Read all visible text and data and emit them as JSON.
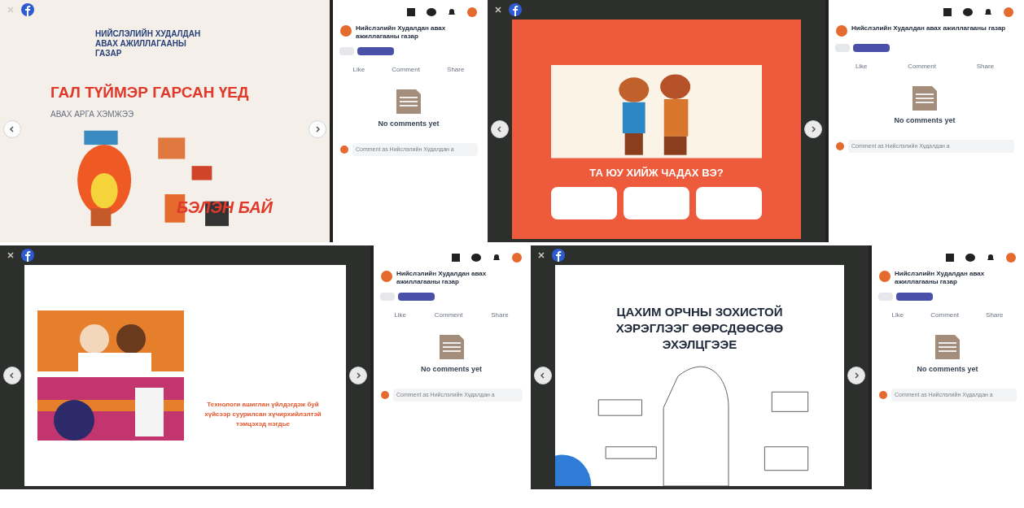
{
  "screens": [
    {
      "poster": {
        "kind": "fire",
        "org": "НИЙСЛЭЛИЙН ХУДАЛДАН АВАХ АЖИЛЛАГААНЫ ГАЗАР",
        "title": "ГАЛ ТҮЙМЭР ГАРСАН ҮЕД",
        "subtitle": "АВАХ АРГА ХЭМЖЭЭ",
        "slogan": "БЭЛЭН БАЙ"
      },
      "sidebar": {
        "author": "Нийслэлийн Худалдан авах ажиллагааны газар",
        "actions": [
          "Like",
          "Comment",
          "Share"
        ],
        "empty": "No comments yet",
        "placeholder": "Comment as Нийслэлийн Худалдан а"
      }
    },
    {
      "poster": {
        "kind": "kids",
        "question": "ТА ЮУ ХИЙЖ ЧАДАХ ВЭ?"
      },
      "sidebar": {
        "author": "Нийслэлийн Худалдан авах ажиллагааны газар",
        "actions": [
          "Like",
          "Comment",
          "Share"
        ],
        "empty": "No comments yet",
        "placeholder": "Comment as Нийслэлийн Худалдан а"
      }
    },
    {
      "poster": {
        "kind": "phones",
        "footer": "Технологи ашиглан үйлдэгдэж буй хүйсээр суурилсан хүчирхийлэлтэй тэмцэхэд нэгдье"
      },
      "sidebar": {
        "author": "Нийслэлийн Худалдан авах ажиллагааны газар",
        "actions": [
          "Like",
          "Comment",
          "Share"
        ],
        "empty": "No comments yet",
        "placeholder": "Comment as Нийслэлийн Худалдан а"
      }
    },
    {
      "poster": {
        "kind": "hands",
        "title": "ЦАХИМ ОРЧНЫ ЗОХИСТОЙ ХЭРЭГЛЭЭГ ӨӨРСДӨӨСӨӨ ЭХЭЛЦГЭЭЕ"
      },
      "sidebar": {
        "author": "Нийслэлийн Худалдан авах ажиллагааны газар",
        "actions": [
          "Like",
          "Comment",
          "Share"
        ],
        "empty": "No comments yet",
        "placeholder": "Comment as Нийслэлийн Худалдан а"
      }
    }
  ]
}
